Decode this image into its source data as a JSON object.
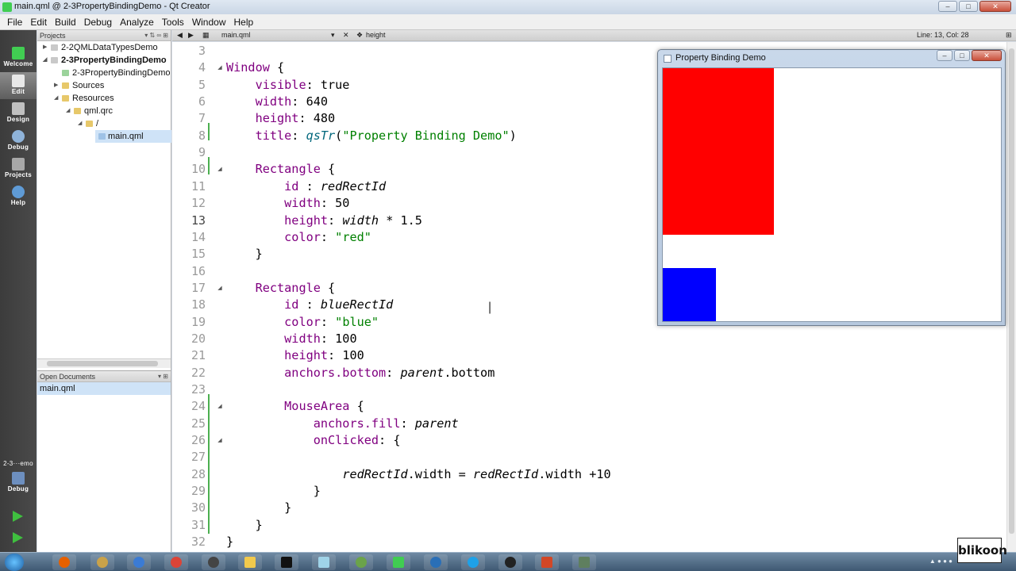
{
  "window": {
    "title": "main.qml @ 2-3PropertyBindingDemo - Qt Creator"
  },
  "menu": [
    "File",
    "Edit",
    "Build",
    "Debug",
    "Analyze",
    "Tools",
    "Window",
    "Help"
  ],
  "modes": [
    {
      "label": "Welcome",
      "icon": "qt-logo-icon"
    },
    {
      "label": "Edit",
      "icon": "edit-document-icon"
    },
    {
      "label": "Design",
      "icon": "design-pencil-icon"
    },
    {
      "label": "Debug",
      "icon": "debug-bug-icon"
    },
    {
      "label": "Projects",
      "icon": "projects-wrench-icon"
    },
    {
      "label": "Help",
      "icon": "help-question-icon"
    }
  ],
  "run_target": {
    "name": "2-3···emo",
    "mode": "Debug"
  },
  "projects": {
    "header": "Projects",
    "items": [
      {
        "label": "2-2QMLDataTypesDemo",
        "bold": false
      },
      {
        "label": "2-3PropertyBindingDemo",
        "bold": true
      },
      {
        "label": "2-3PropertyBindingDemo",
        "bold": false
      },
      {
        "label": "Sources",
        "bold": false
      },
      {
        "label": "Resources",
        "bold": false
      },
      {
        "label": "qml.qrc",
        "bold": false
      },
      {
        "label": "/",
        "bold": false
      },
      {
        "label": "main.qml",
        "bold": false
      }
    ]
  },
  "open_documents": {
    "header": "Open Documents",
    "items": [
      "main.qml"
    ]
  },
  "editor": {
    "file": "main.qml",
    "symbol": "height",
    "position": "Line: 13, Col: 28",
    "current_line": 13
  },
  "code_lines": [
    {
      "n": "3",
      "html": ""
    },
    {
      "n": "4",
      "html": "<span class=\"ty\">Window</span> {"
    },
    {
      "n": "5",
      "html": "    <span class=\"ty\">visible</span>: true"
    },
    {
      "n": "6",
      "html": "    <span class=\"ty\">width</span>: 640"
    },
    {
      "n": "7",
      "html": "    <span class=\"ty\">height</span>: 480"
    },
    {
      "n": "8",
      "html": "    <span class=\"ty\">title</span>: <span class=\"fn\">qsTr</span>(<span class=\"st\">\"Property Binding Demo\"</span>)"
    },
    {
      "n": "9",
      "html": ""
    },
    {
      "n": "10",
      "html": "    <span class=\"ty\">Rectangle</span> {"
    },
    {
      "n": "11",
      "html": "        <span class=\"ty\">id</span> : <span class=\"it\">redRectId</span>"
    },
    {
      "n": "12",
      "html": "        <span class=\"ty\">width</span>: 50"
    },
    {
      "n": "13",
      "html": "        <span class=\"ty\">height</span>: <span class=\"it\">width</span> * 1.5"
    },
    {
      "n": "14",
      "html": "        <span class=\"ty\">color</span>: <span class=\"st\">\"red\"</span>"
    },
    {
      "n": "15",
      "html": "    }"
    },
    {
      "n": "16",
      "html": ""
    },
    {
      "n": "17",
      "html": "    <span class=\"ty\">Rectangle</span> {"
    },
    {
      "n": "18",
      "html": "        <span class=\"ty\">id</span> : <span class=\"it\">blueRectId</span>"
    },
    {
      "n": "19",
      "html": "        <span class=\"ty\">color</span>: <span class=\"st\">\"blue\"</span>"
    },
    {
      "n": "20",
      "html": "        <span class=\"ty\">width</span>: 100"
    },
    {
      "n": "21",
      "html": "        <span class=\"ty\">height</span>: 100"
    },
    {
      "n": "22",
      "html": "        <span class=\"ty\">anchors.bottom</span>: <span class=\"it\">parent</span>.bottom"
    },
    {
      "n": "23",
      "html": ""
    },
    {
      "n": "24",
      "html": "        <span class=\"ty\">MouseArea</span> {"
    },
    {
      "n": "25",
      "html": "            <span class=\"ty\">anchors.fill</span>: <span class=\"it\">parent</span>"
    },
    {
      "n": "26",
      "html": "            <span class=\"ty\">onClicked</span>: {"
    },
    {
      "n": "27",
      "html": ""
    },
    {
      "n": "28",
      "html": "                <span class=\"it\">redRectId</span>.width = <span class=\"it\">redRectId</span>.width +10"
    },
    {
      "n": "29",
      "html": "            }"
    },
    {
      "n": "30",
      "html": "        }"
    },
    {
      "n": "31",
      "html": "    }"
    },
    {
      "n": "32",
      "html": "}"
    }
  ],
  "fold_lines": [
    "4",
    "10",
    "17",
    "24",
    "26"
  ],
  "demo_window": {
    "title": "Property Binding Demo",
    "red_color": "#ff0000",
    "blue_color": "#0000ff"
  },
  "watermark": "blikoon"
}
